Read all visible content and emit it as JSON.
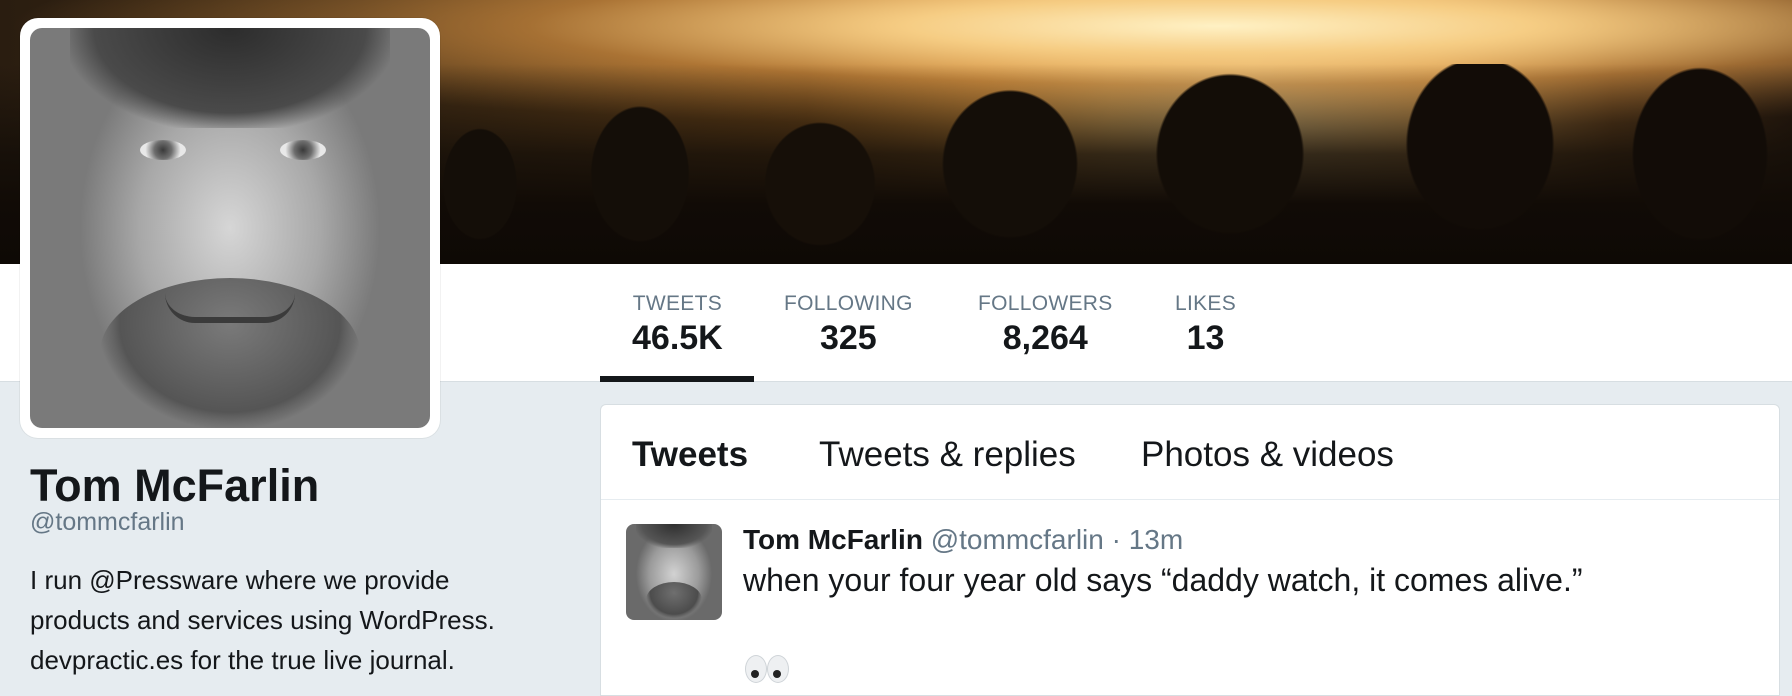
{
  "stats": [
    {
      "label": "TWEETS",
      "value": "46.5K",
      "active": true
    },
    {
      "label": "FOLLOWING",
      "value": "325",
      "active": false
    },
    {
      "label": "FOLLOWERS",
      "value": "8,264",
      "active": false
    },
    {
      "label": "LIKES",
      "value": "13",
      "active": false
    }
  ],
  "profile": {
    "name": "Tom McFarlin",
    "handle": "@tommcfarlin",
    "bio": {
      "part1": "I run ",
      "link1": "@Pressware",
      "part2": " where we provide products and services using WordPress. ",
      "link2": "devpractic.es",
      "part3": " for the true live journal."
    }
  },
  "timeline": {
    "tabs": [
      {
        "label": "Tweets",
        "active": true
      },
      {
        "label": "Tweets & replies",
        "active": false
      },
      {
        "label": "Photos & videos",
        "active": false
      }
    ],
    "tweet": {
      "author": "Tom McFarlin",
      "handle": "@tommcfarlin",
      "separator": "·",
      "time": "13m",
      "text": "when your four year old says “daddy watch, it comes alive.”",
      "emoji_icon": "eyes-icon"
    }
  }
}
